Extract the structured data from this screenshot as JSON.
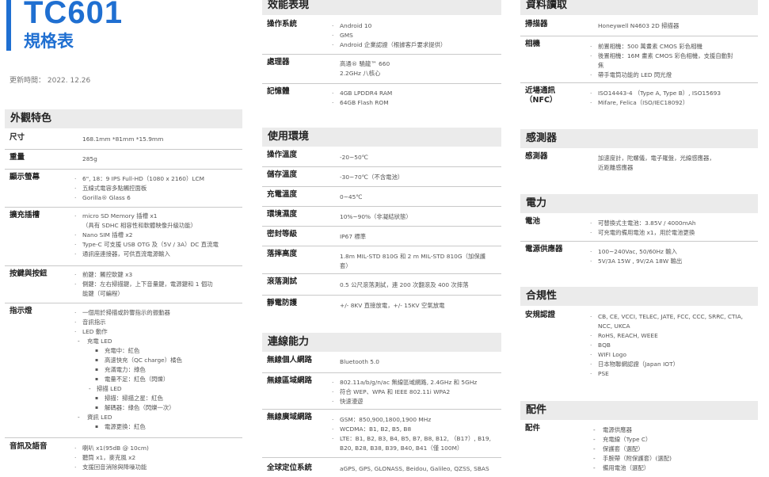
{
  "header": {
    "model": "TC601",
    "subtitle": "規格表",
    "updated": "更新時間： 2022. 12.26"
  },
  "appearance": {
    "title": "外觀特色",
    "rows": [
      {
        "label": "尺寸",
        "items": [
          "168.1mm *81mm *15.9mm"
        ]
      },
      {
        "label": "重量",
        "items": [
          "285g"
        ]
      },
      {
        "label": "顯示螢幕",
        "items": [
          "6\", 18：9 IPS Full-HD（1080 x 2160）LCM",
          "五線式電容多點觸控面板",
          "Gorilla® Glass 6"
        ]
      },
      {
        "label": "擴充插槽",
        "items": [
          "micro SD Memory 插槽 x1",
          "（具有 SDHC 相容性和軟體映像升級功能）",
          "Nano SIM 插槽 x2",
          "Type-C 可支援 USB OTG 及（5V / 3A）DC 直流電",
          "通訊座連接器，可供直流電源輸入"
        ]
      },
      {
        "label": "按鍵與按鈕",
        "items": [
          "前鍵：觸控軟鍵 x3",
          "側鍵：左右掃描鍵，上下音量鍵，電源鍵和 1 個功",
          "能鍵（可編程）"
        ]
      },
      {
        "label": "指示燈",
        "items": [
          "一個用於掃描或鈴響指示的振動器",
          "音訊指示",
          "LED 動作",
          "充電 LED",
          "充電中：紅色",
          "高速快充（QC charge）橘色",
          "充滿電力：綠色",
          "電量不足：紅色（閃爍）",
          "掃描 LED",
          "掃描：掃描之星：紅色",
          "解碼器：綠色（閃爍一次）",
          "資訊 LED",
          "電源更換：紅色"
        ]
      },
      {
        "label": "音訊及語音",
        "items": [
          "喇叭 x1(95dB @ 10cm)",
          "聽筒 x1，麥克風 x2",
          "支援回音消除與降噪功能"
        ]
      }
    ]
  },
  "performance": {
    "title": "效能表現",
    "rows": [
      {
        "label": "操作系統",
        "items": [
          "Android 10",
          "GMS",
          "Android 企業認證（根據客戶要求提供）"
        ]
      },
      {
        "label": "處理器",
        "items": [
          "高通® 驍龍™ 660",
          "2.2GHz 八核心"
        ]
      },
      {
        "label": "記憶體",
        "items": [
          "4GB LPDDR4 RAM",
          "64GB Flash ROM"
        ]
      }
    ]
  },
  "environment": {
    "title": "使用環境",
    "rows": [
      {
        "label": "操作溫度",
        "items": [
          "-20~50℃"
        ]
      },
      {
        "label": "儲存溫度",
        "items": [
          "-30~70℃（不含電池）"
        ]
      },
      {
        "label": "充電溫度",
        "items": [
          "0~45℃"
        ]
      },
      {
        "label": "環境濕度",
        "items": [
          "10%~90%（非凝結狀態）"
        ]
      },
      {
        "label": "密封等級",
        "items": [
          "IP67 標準"
        ]
      },
      {
        "label": "落摔高度",
        "items": [
          "1.8m MIL-STD 810G 和 2 m MIL-STD 810G（加保護",
          "套）"
        ]
      },
      {
        "label": "滾落測試",
        "items": [
          "0.5 公尺滾落測試，連 200 次翻滾及 400 次摔落"
        ]
      },
      {
        "label": "靜電防護",
        "items": [
          "+/- 8KV 直接放電，+/- 15KV 空氣放電"
        ]
      }
    ]
  },
  "connectivity": {
    "title": "連線能力",
    "rows": [
      {
        "label": "無線個人網路",
        "items": [
          "Bluetooth 5.0"
        ]
      },
      {
        "label": "無線區域網路",
        "items": [
          "802.11a/b/g/n/ac 無線區域網路, 2.4GHz 和 5GHz",
          "符合 WEP、WPA 和 IEEE 802.11i WPA2",
          "快速漫遊"
        ]
      },
      {
        "label": "無線廣域網路",
        "items": [
          "GSM：850,900,1800,1900 MHz",
          "WCDMA：B1, B2, B5, B8",
          "LTE：B1, B2, B3, B4, B5, B7, B8, B12, （B17）, B19,",
          "B20, B28, B38, B39, B40, B41（僅 100M）"
        ]
      },
      {
        "label": "全球定位系統",
        "items": [
          "aGPS, GPS, GLONASS, Beidou, Galileo, QZSS, SBAS"
        ]
      }
    ]
  },
  "data_capture": {
    "title": "資料讀取",
    "rows": [
      {
        "label": "掃描器",
        "items": [
          "Honeywell N4603 2D 掃描器"
        ]
      },
      {
        "label": "相機",
        "items": [
          "前置相機：500 萬畫素 CMOS 彩色相機",
          "後置相機：16M 畫素 CMOS 彩色相機，支援自動對",
          "焦",
          "帶手電筒功能的 LED 閃光燈"
        ]
      },
      {
        "label": "近場通訊",
        "label2": "（NFC）",
        "items": [
          "ISO14443-4 （Type A, Type B）, ISO15693",
          "Mifare, Felica（ISO/IEC18092）"
        ]
      }
    ]
  },
  "sensors": {
    "title": "感測器",
    "rows": [
      {
        "label": "感測器",
        "items": [
          "加速度計，陀螺儀，電子羅盤，光線感應器，",
          "近距離感應器"
        ]
      }
    ]
  },
  "power": {
    "title": "電力",
    "rows": [
      {
        "label": "電池",
        "items": [
          "可替換式主電池：3.85V / 4000mAh",
          "可充電的備用電池 x1，用於電池更換"
        ]
      },
      {
        "label": "電源供應器",
        "items": [
          "100~240Vac, 50/60Hz 輸入",
          "5V/3A 15W , 9V/2A 18W 輸出"
        ]
      }
    ]
  },
  "compliance": {
    "title": "合規性",
    "rows": [
      {
        "label": "安規認證",
        "items": [
          "CB, CE, VCCI, TELEC, JATE, FCC, CCC, SRRC, CTIA,",
          "NCC, UKCA",
          "RoHS, REACH, WEEE",
          "BQB",
          "WIFI Logo",
          "日本物聯網認證（Japan IOT）",
          "PSE"
        ]
      }
    ]
  },
  "accessories": {
    "title": "配件",
    "rows": [
      {
        "label": "配件",
        "items": [
          "電源供應器",
          "充電線（Type C）",
          "保護套（選配）",
          "手腕帶（附保護套）(選配)",
          "備用電池（選配）"
        ]
      }
    ]
  }
}
